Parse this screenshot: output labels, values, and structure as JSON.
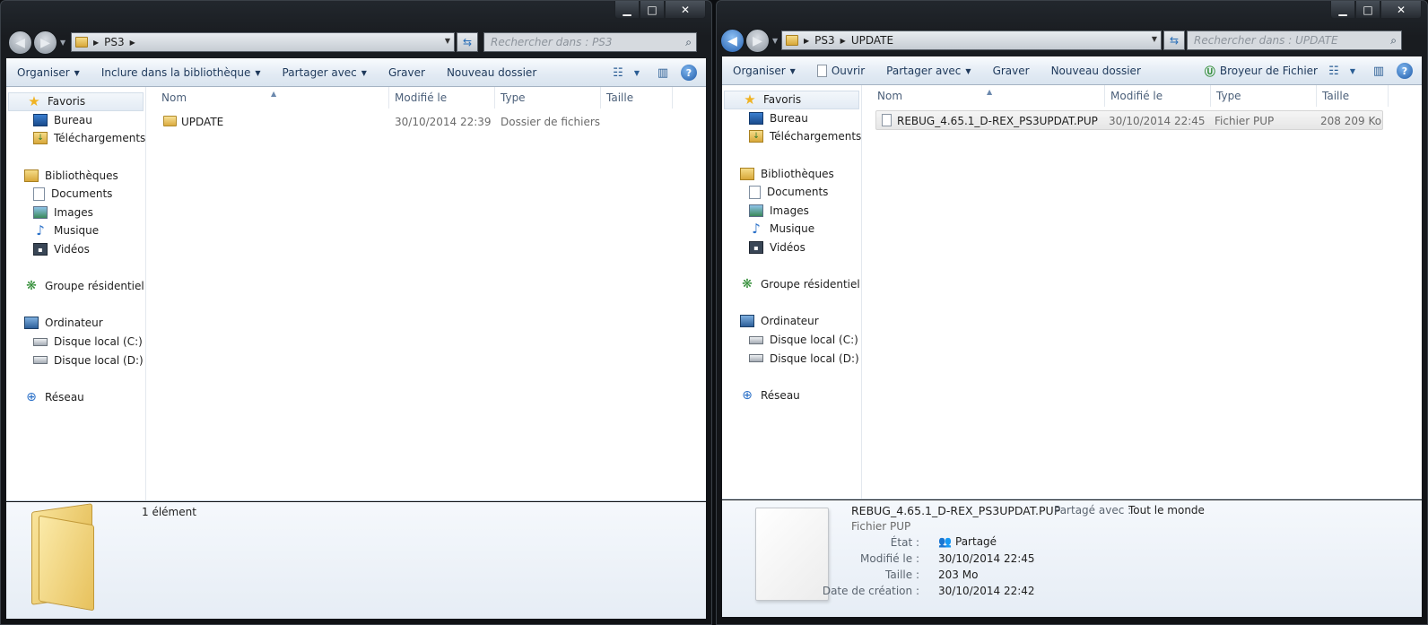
{
  "caption": {
    "min": "▁",
    "max": "□",
    "close": "✕"
  },
  "left": {
    "address": {
      "crumbs": [
        "PS3"
      ]
    },
    "search": {
      "placeholder": "Rechercher dans : PS3"
    },
    "cmd": {
      "organize": "Organiser",
      "include": "Inclure dans la bibliothèque",
      "share": "Partager avec",
      "burn": "Graver",
      "newfolder": "Nouveau dossier"
    },
    "columns": {
      "name": "Nom",
      "modified": "Modifié le",
      "type": "Type",
      "size": "Taille"
    },
    "rows": [
      {
        "name": "UPDATE",
        "modified": "30/10/2014 22:39",
        "type": "Dossier de fichiers",
        "size": ""
      }
    ],
    "details": {
      "count": "1 élément"
    }
  },
  "right": {
    "address": {
      "crumbs": [
        "PS3",
        "UPDATE"
      ]
    },
    "search": {
      "placeholder": "Rechercher dans : UPDATE"
    },
    "cmd": {
      "organize": "Organiser",
      "open": "Ouvrir",
      "share": "Partager avec",
      "burn": "Graver",
      "newfolder": "Nouveau dossier",
      "shredder": "Broyeur de Fichier"
    },
    "columns": {
      "name": "Nom",
      "modified": "Modifié le",
      "type": "Type",
      "size": "Taille"
    },
    "rows": [
      {
        "name": "REBUG_4.65.1_D-REX_PS3UPDAT.PUP",
        "modified": "30/10/2014 22:45",
        "type": "Fichier PUP",
        "size": "208 209 Ko"
      }
    ],
    "details": {
      "filename": "REBUG_4.65.1_D-REX_PS3UPDAT.PUP",
      "filetype": "Fichier PUP",
      "shared_label": "Partagé avec :",
      "shared_value": "Tout le monde",
      "state_label": "État :",
      "state_value": "Partagé",
      "modified_label": "Modifié le :",
      "modified_value": "30/10/2014 22:45",
      "size_label": "Taille :",
      "size_value": "203 Mo",
      "created_label": "Date de création :",
      "created_value": "30/10/2014 22:42"
    }
  },
  "nav": {
    "favorites": "Favoris",
    "desktop": "Bureau",
    "downloads": "Téléchargements",
    "libraries": "Bibliothèques",
    "documents": "Documents",
    "images": "Images",
    "music": "Musique",
    "videos": "Vidéos",
    "homegroup": "Groupe résidentiel",
    "computer": "Ordinateur",
    "driveC": "Disque local (C:)",
    "driveD": "Disque local (D:)",
    "network": "Réseau"
  },
  "colors": {
    "accent": "#1e395b",
    "selection": "#e6e6e6"
  }
}
